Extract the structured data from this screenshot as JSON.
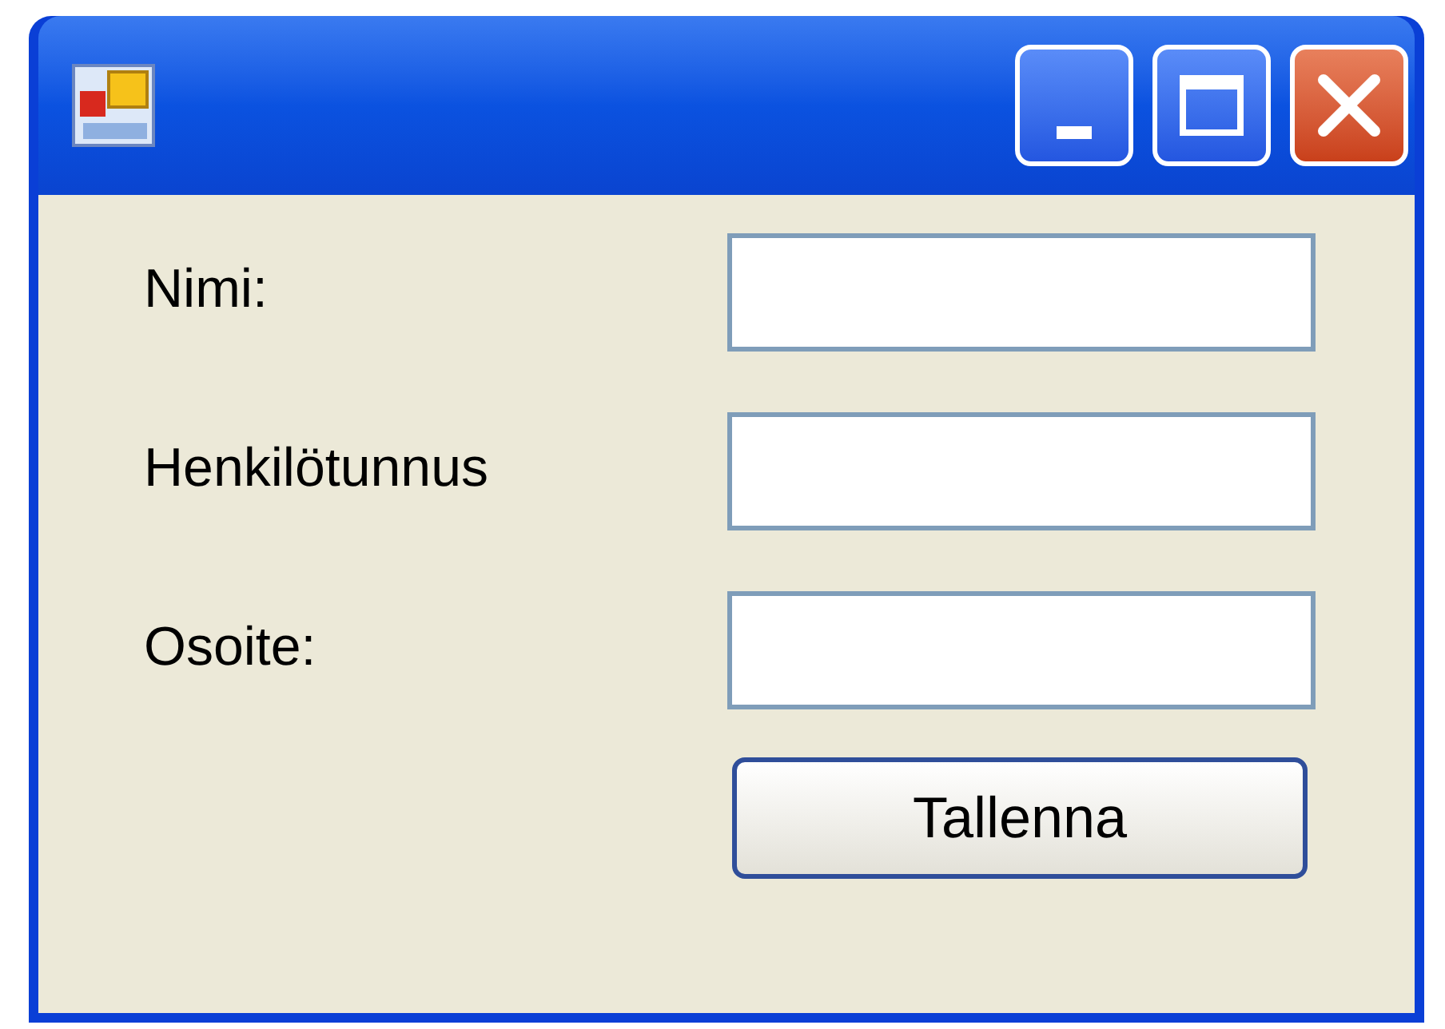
{
  "window": {
    "title_buttons": [
      {
        "kind": "minimize"
      },
      {
        "kind": "maximize"
      },
      {
        "kind": "close"
      }
    ]
  },
  "fields": [
    {
      "label": "Nimi:"
    },
    {
      "label": "Henkilötunnus"
    },
    {
      "label": "Osoite:"
    }
  ],
  "button": {
    "label": "Tallenna"
  }
}
